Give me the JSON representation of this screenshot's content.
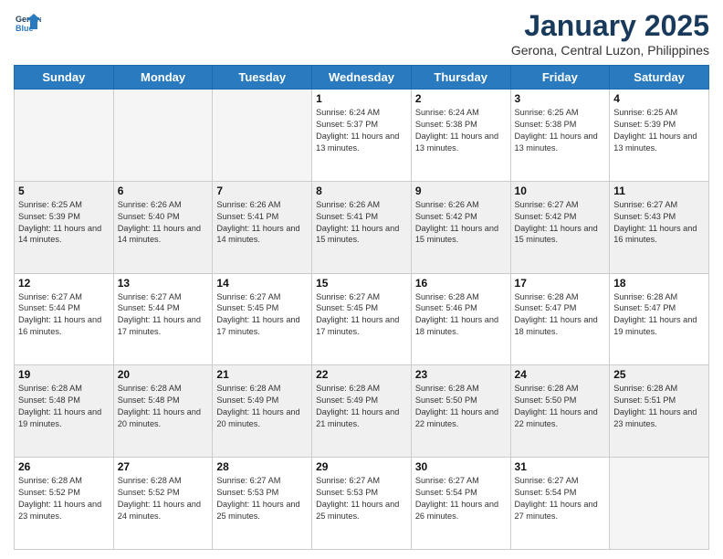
{
  "header": {
    "logo_general": "General",
    "logo_blue": "Blue",
    "month_title": "January 2025",
    "subtitle": "Gerona, Central Luzon, Philippines"
  },
  "weekdays": [
    "Sunday",
    "Monday",
    "Tuesday",
    "Wednesday",
    "Thursday",
    "Friday",
    "Saturday"
  ],
  "weeks": [
    [
      {
        "day": "",
        "sunrise": "",
        "sunset": "",
        "daylight": "",
        "empty": true
      },
      {
        "day": "",
        "sunrise": "",
        "sunset": "",
        "daylight": "",
        "empty": true
      },
      {
        "day": "",
        "sunrise": "",
        "sunset": "",
        "daylight": "",
        "empty": true
      },
      {
        "day": "1",
        "sunrise": "Sunrise: 6:24 AM",
        "sunset": "Sunset: 5:37 PM",
        "daylight": "Daylight: 11 hours and 13 minutes."
      },
      {
        "day": "2",
        "sunrise": "Sunrise: 6:24 AM",
        "sunset": "Sunset: 5:38 PM",
        "daylight": "Daylight: 11 hours and 13 minutes."
      },
      {
        "day": "3",
        "sunrise": "Sunrise: 6:25 AM",
        "sunset": "Sunset: 5:38 PM",
        "daylight": "Daylight: 11 hours and 13 minutes."
      },
      {
        "day": "4",
        "sunrise": "Sunrise: 6:25 AM",
        "sunset": "Sunset: 5:39 PM",
        "daylight": "Daylight: 11 hours and 13 minutes."
      }
    ],
    [
      {
        "day": "5",
        "sunrise": "Sunrise: 6:25 AM",
        "sunset": "Sunset: 5:39 PM",
        "daylight": "Daylight: 11 hours and 14 minutes."
      },
      {
        "day": "6",
        "sunrise": "Sunrise: 6:26 AM",
        "sunset": "Sunset: 5:40 PM",
        "daylight": "Daylight: 11 hours and 14 minutes."
      },
      {
        "day": "7",
        "sunrise": "Sunrise: 6:26 AM",
        "sunset": "Sunset: 5:41 PM",
        "daylight": "Daylight: 11 hours and 14 minutes."
      },
      {
        "day": "8",
        "sunrise": "Sunrise: 6:26 AM",
        "sunset": "Sunset: 5:41 PM",
        "daylight": "Daylight: 11 hours and 15 minutes."
      },
      {
        "day": "9",
        "sunrise": "Sunrise: 6:26 AM",
        "sunset": "Sunset: 5:42 PM",
        "daylight": "Daylight: 11 hours and 15 minutes."
      },
      {
        "day": "10",
        "sunrise": "Sunrise: 6:27 AM",
        "sunset": "Sunset: 5:42 PM",
        "daylight": "Daylight: 11 hours and 15 minutes."
      },
      {
        "day": "11",
        "sunrise": "Sunrise: 6:27 AM",
        "sunset": "Sunset: 5:43 PM",
        "daylight": "Daylight: 11 hours and 16 minutes."
      }
    ],
    [
      {
        "day": "12",
        "sunrise": "Sunrise: 6:27 AM",
        "sunset": "Sunset: 5:44 PM",
        "daylight": "Daylight: 11 hours and 16 minutes."
      },
      {
        "day": "13",
        "sunrise": "Sunrise: 6:27 AM",
        "sunset": "Sunset: 5:44 PM",
        "daylight": "Daylight: 11 hours and 17 minutes."
      },
      {
        "day": "14",
        "sunrise": "Sunrise: 6:27 AM",
        "sunset": "Sunset: 5:45 PM",
        "daylight": "Daylight: 11 hours and 17 minutes."
      },
      {
        "day": "15",
        "sunrise": "Sunrise: 6:27 AM",
        "sunset": "Sunset: 5:45 PM",
        "daylight": "Daylight: 11 hours and 17 minutes."
      },
      {
        "day": "16",
        "sunrise": "Sunrise: 6:28 AM",
        "sunset": "Sunset: 5:46 PM",
        "daylight": "Daylight: 11 hours and 18 minutes."
      },
      {
        "day": "17",
        "sunrise": "Sunrise: 6:28 AM",
        "sunset": "Sunset: 5:47 PM",
        "daylight": "Daylight: 11 hours and 18 minutes."
      },
      {
        "day": "18",
        "sunrise": "Sunrise: 6:28 AM",
        "sunset": "Sunset: 5:47 PM",
        "daylight": "Daylight: 11 hours and 19 minutes."
      }
    ],
    [
      {
        "day": "19",
        "sunrise": "Sunrise: 6:28 AM",
        "sunset": "Sunset: 5:48 PM",
        "daylight": "Daylight: 11 hours and 19 minutes."
      },
      {
        "day": "20",
        "sunrise": "Sunrise: 6:28 AM",
        "sunset": "Sunset: 5:48 PM",
        "daylight": "Daylight: 11 hours and 20 minutes."
      },
      {
        "day": "21",
        "sunrise": "Sunrise: 6:28 AM",
        "sunset": "Sunset: 5:49 PM",
        "daylight": "Daylight: 11 hours and 20 minutes."
      },
      {
        "day": "22",
        "sunrise": "Sunrise: 6:28 AM",
        "sunset": "Sunset: 5:49 PM",
        "daylight": "Daylight: 11 hours and 21 minutes."
      },
      {
        "day": "23",
        "sunrise": "Sunrise: 6:28 AM",
        "sunset": "Sunset: 5:50 PM",
        "daylight": "Daylight: 11 hours and 22 minutes."
      },
      {
        "day": "24",
        "sunrise": "Sunrise: 6:28 AM",
        "sunset": "Sunset: 5:50 PM",
        "daylight": "Daylight: 11 hours and 22 minutes."
      },
      {
        "day": "25",
        "sunrise": "Sunrise: 6:28 AM",
        "sunset": "Sunset: 5:51 PM",
        "daylight": "Daylight: 11 hours and 23 minutes."
      }
    ],
    [
      {
        "day": "26",
        "sunrise": "Sunrise: 6:28 AM",
        "sunset": "Sunset: 5:52 PM",
        "daylight": "Daylight: 11 hours and 23 minutes."
      },
      {
        "day": "27",
        "sunrise": "Sunrise: 6:28 AM",
        "sunset": "Sunset: 5:52 PM",
        "daylight": "Daylight: 11 hours and 24 minutes."
      },
      {
        "day": "28",
        "sunrise": "Sunrise: 6:27 AM",
        "sunset": "Sunset: 5:53 PM",
        "daylight": "Daylight: 11 hours and 25 minutes."
      },
      {
        "day": "29",
        "sunrise": "Sunrise: 6:27 AM",
        "sunset": "Sunset: 5:53 PM",
        "daylight": "Daylight: 11 hours and 25 minutes."
      },
      {
        "day": "30",
        "sunrise": "Sunrise: 6:27 AM",
        "sunset": "Sunset: 5:54 PM",
        "daylight": "Daylight: 11 hours and 26 minutes."
      },
      {
        "day": "31",
        "sunrise": "Sunrise: 6:27 AM",
        "sunset": "Sunset: 5:54 PM",
        "daylight": "Daylight: 11 hours and 27 minutes."
      },
      {
        "day": "",
        "sunrise": "",
        "sunset": "",
        "daylight": "",
        "empty": true
      }
    ]
  ]
}
